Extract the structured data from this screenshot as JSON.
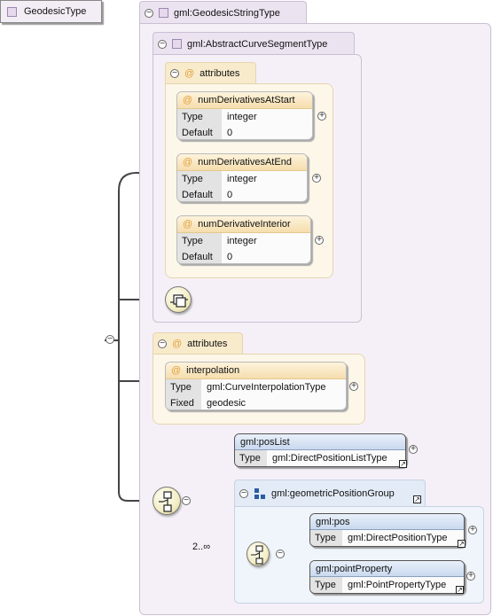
{
  "root": {
    "name": "GeodesicType"
  },
  "extension": {
    "label": "gml:GeodesicStringType"
  },
  "base": {
    "label": "gml:AbstractCurveSegmentType"
  },
  "attr_group_1": {
    "label": "attributes",
    "items": [
      {
        "name": "numDerivativesAtStart",
        "type_key": "Type",
        "type_val": "integer",
        "default_key": "Default",
        "default_val": "0"
      },
      {
        "name": "numDerivativesAtEnd",
        "type_key": "Type",
        "type_val": "integer",
        "default_key": "Default",
        "default_val": "0"
      },
      {
        "name": "numDerivativeInterior",
        "type_key": "Type",
        "type_val": "integer",
        "default_key": "Default",
        "default_val": "0"
      }
    ]
  },
  "attr_group_2": {
    "label": "attributes",
    "items": [
      {
        "name": "interpolation",
        "type_key": "Type",
        "type_val": "gml:CurveInterpolationType",
        "fixed_key": "Fixed",
        "fixed_val": "geodesic"
      }
    ]
  },
  "poslist": {
    "name": "gml:posList",
    "type_key": "Type",
    "type_val": "gml:DirectPositionListType"
  },
  "group": {
    "label": "gml:geometricPositionGroup",
    "cardinality": "2..∞"
  },
  "pos": {
    "name": "gml:pos",
    "type_key": "Type",
    "type_val": "gml:DirectPositionType"
  },
  "pointproperty": {
    "name": "gml:pointProperty",
    "type_key": "Type",
    "type_val": "gml:PointPropertyType"
  },
  "icons": {
    "collapse": "minus-icon",
    "expand": "plus-icon",
    "attribute": "at-icon",
    "sequence": "sequence-icon",
    "choice": "choice-icon",
    "reference": "reference-arrow-icon"
  }
}
